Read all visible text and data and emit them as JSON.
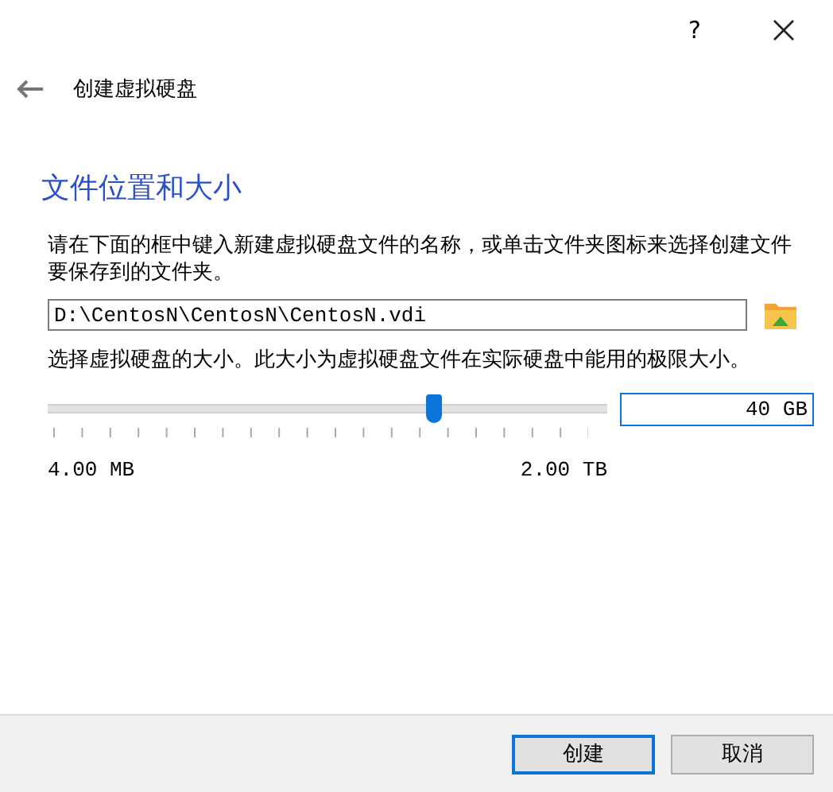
{
  "window": {
    "help": "?"
  },
  "header": {
    "title": "创建虚拟硬盘"
  },
  "section": {
    "heading": "文件位置和大小",
    "location_text": "请在下面的框中键入新建虚拟硬盘文件的名称，或单击文件夹图标来选择创建文件要保存到的文件夹。",
    "location_field": {
      "value": "D:\\CentosN\\CentosN\\CentosN.vdi"
    },
    "size_text": "选择虚拟硬盘的大小。此大小为虚拟硬盘文件在实际硬盘中能用的极限大小。",
    "size_slider": {
      "level": 0.69,
      "min_label": "4.00 MB",
      "max_label": "2.00 TB"
    },
    "size_field": {
      "value": "40 GB"
    }
  },
  "buttons": [
    {
      "label": "创建",
      "selected": true
    },
    {
      "label": "取消",
      "selected": false
    }
  ]
}
